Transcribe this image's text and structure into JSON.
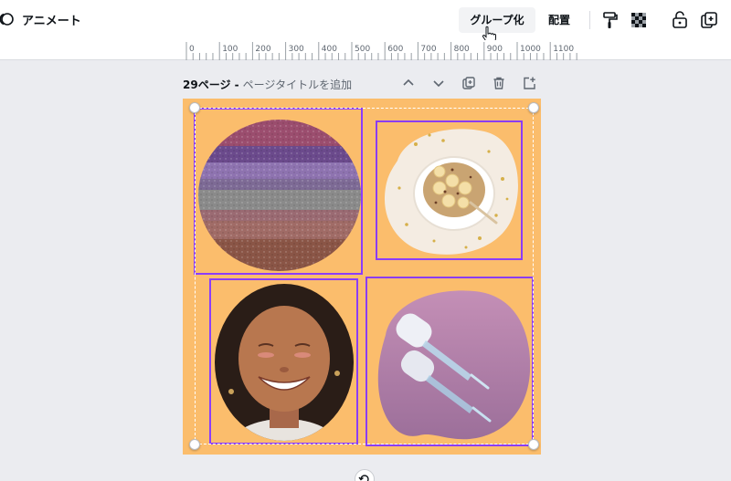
{
  "toolbar": {
    "animate_label": "アニメート",
    "group_label": "グループ化",
    "arrange_label": "配置"
  },
  "ruler": {
    "ticks": [
      "0",
      "100",
      "200",
      "300",
      "400",
      "500",
      "600",
      "700",
      "800",
      "900",
      "1000",
      "1100"
    ]
  },
  "page": {
    "number_label": "29ページ -",
    "title_placeholder": "ページタイトルを追加"
  },
  "colors": {
    "canvas_bg": "#fbbd6c",
    "selection": "#8b3dff",
    "workspace": "#ebecf0"
  },
  "canvas": {
    "cells": [
      {
        "name": "frame-rainbow-texture",
        "content": "striped purple/grey/brown texture circle"
      },
      {
        "name": "frame-smoothie-bowl",
        "content": "bowl of granola and banana"
      },
      {
        "name": "frame-smiling-woman",
        "content": "smiling woman portrait"
      },
      {
        "name": "frame-dropper-bottles",
        "content": "dropper bottles on pink"
      }
    ]
  }
}
